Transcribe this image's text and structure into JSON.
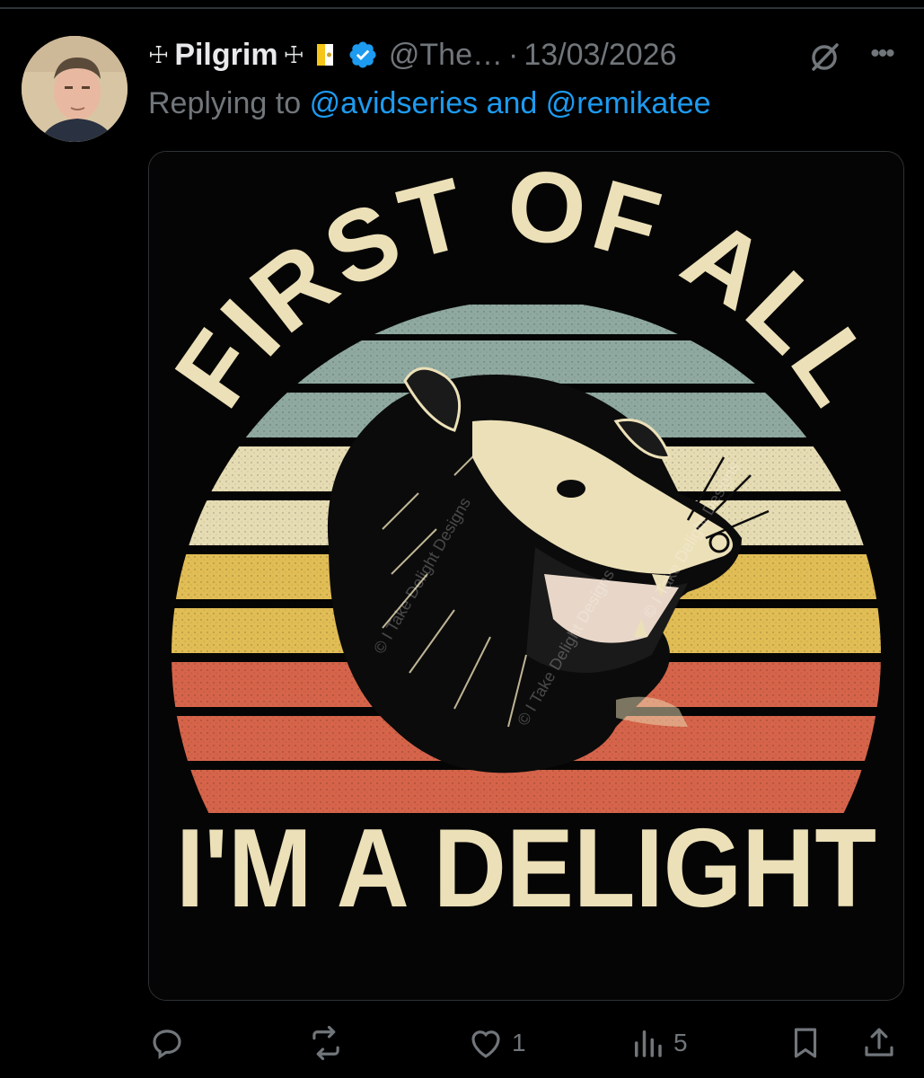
{
  "tweet": {
    "display_name": "Pilgrim",
    "name_prefix": "☩",
    "name_suffix": "☩",
    "handle": "@The…",
    "separator": "·",
    "date": "13/03/2026",
    "more_label": "•••",
    "replying_prefix": "Replying to",
    "replying_mentions": "@avidseries and @remikatee",
    "icons": {
      "flag": "vatican-flag-icon",
      "verified": "verified-badge-icon",
      "grok": "grok-icon",
      "more": "more-icon"
    }
  },
  "image": {
    "top_text": "FIRST OF ALL",
    "bottom_text": "I'M A DELIGHT",
    "watermark": "© I Take Delight Designs",
    "colors": {
      "text": "#ece0b8",
      "stripe_teal": "#8fa9a0",
      "stripe_cream": "#e6dcb3",
      "stripe_yellow": "#e1bd55",
      "stripe_red": "#d5644a",
      "background": "#050505"
    }
  },
  "actions": {
    "reply_count": "",
    "retweet_count": "",
    "like_count": "1",
    "views_count": "5",
    "icons": [
      "reply-icon",
      "retweet-icon",
      "like-icon",
      "views-icon",
      "bookmark-icon",
      "share-icon"
    ]
  }
}
